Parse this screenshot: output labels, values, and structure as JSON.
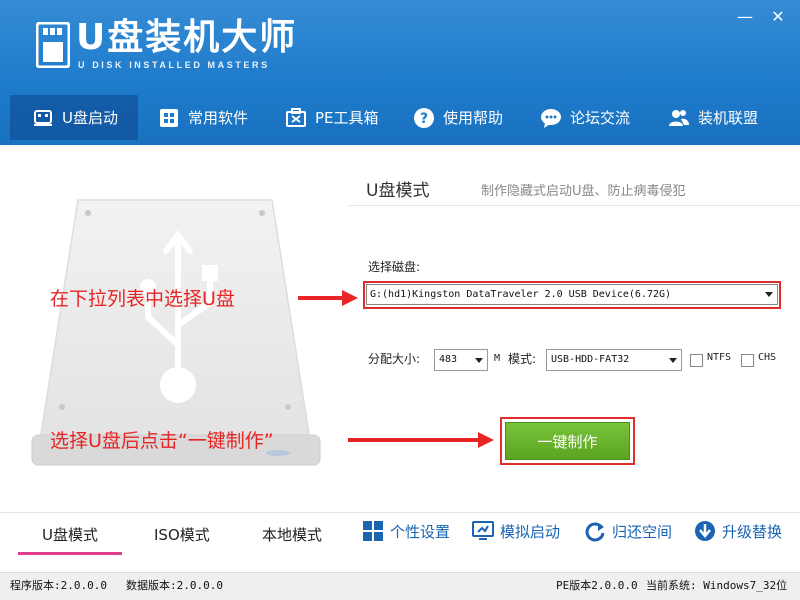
{
  "app": {
    "title": "U盘装机大师",
    "subtitle": "U DISK INSTALLED MASTERS",
    "window_controls": {
      "minimize": "—",
      "close": "✕"
    }
  },
  "nav": [
    {
      "label": "U盘启动",
      "icon": "usb-drive-icon",
      "active": true
    },
    {
      "label": "常用软件",
      "icon": "puzzle-icon"
    },
    {
      "label": "PE工具箱",
      "icon": "toolbox-icon"
    },
    {
      "label": "使用帮助",
      "icon": "help-icon"
    },
    {
      "label": "论坛交流",
      "icon": "chat-icon"
    },
    {
      "label": "装机联盟",
      "icon": "users-icon"
    }
  ],
  "main": {
    "mode_title": "U盘模式",
    "mode_desc": "制作隐藏式启动U盘、防止病毒侵犯",
    "disk_label": "选择磁盘:",
    "disk_value": "G:(hd1)Kingston DataTraveler 2.0 USB Device(6.72G)",
    "alloc_label": "分配大小:",
    "alloc_value": "483",
    "alloc_unit": "M",
    "mode_label": "模式:",
    "mode_value": "USB-HDD-FAT32",
    "ntfs_label": "NTFS",
    "chs_label": "CHS",
    "make_button": "一键制作"
  },
  "annotations": {
    "select_disk": "在下拉列表中选择U盘",
    "click_make": "选择U盘后点击“一键制作”",
    "color": "#e82525"
  },
  "bottom_tabs": [
    {
      "label": "U盘模式",
      "active": true
    },
    {
      "label": "ISO模式"
    },
    {
      "label": "本地模式"
    }
  ],
  "bottom_actions": [
    {
      "label": "个性设置",
      "icon": "grid-icon"
    },
    {
      "label": "模拟启动",
      "icon": "monitor-icon"
    },
    {
      "label": "归还空间",
      "icon": "refresh-icon"
    },
    {
      "label": "升级替换",
      "icon": "download-icon"
    }
  ],
  "status": {
    "program_version": "程序版本:2.0.0.0",
    "data_version": "数据版本:2.0.0.0",
    "pe_version": "PE版本2.0.0.0",
    "system": "当前系统: Windows7_32位"
  },
  "colors": {
    "header_blue": "#1d7bcb",
    "make_green": "#6bb52d",
    "annotation_red": "#e82525",
    "active_tab_pink": "#e23f8f"
  }
}
